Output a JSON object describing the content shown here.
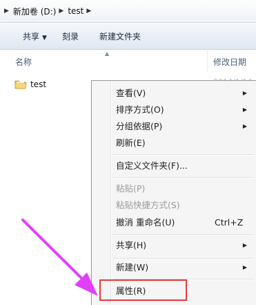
{
  "address_bar": {
    "segments": [
      "新加卷 (D:)",
      "test"
    ]
  },
  "toolbar": {
    "share_label": "共享",
    "burn_label": "刻录",
    "new_folder_label": "新建文件夹"
  },
  "columns": {
    "name": "名称",
    "date_modified": "修改日期"
  },
  "files": [
    {
      "name": "test",
      "date": "2014/1/14",
      "icon": "folder-icon"
    }
  ],
  "context_menu": {
    "items": [
      {
        "label": "查看(V)",
        "submenu": true
      },
      {
        "label": "排序方式(O)",
        "submenu": true
      },
      {
        "label": "分组依据(P)",
        "submenu": true
      },
      {
        "label": "刷新(E)"
      },
      {
        "label": "自定义文件夹(F)..."
      },
      {
        "label": "粘贴(P)",
        "disabled": true
      },
      {
        "label": "粘贴快捷方式(S)",
        "disabled": true
      },
      {
        "label": "撤消 重命名(U)",
        "shortcut": "Ctrl+Z"
      },
      {
        "label": "共享(H)",
        "submenu": true
      },
      {
        "label": "新建(W)",
        "submenu": true
      },
      {
        "label": "属性(R)",
        "highlighted": true
      }
    ]
  },
  "annotation": {
    "arrow_color": "#e040fb",
    "highlight_color": "#e8383d"
  }
}
